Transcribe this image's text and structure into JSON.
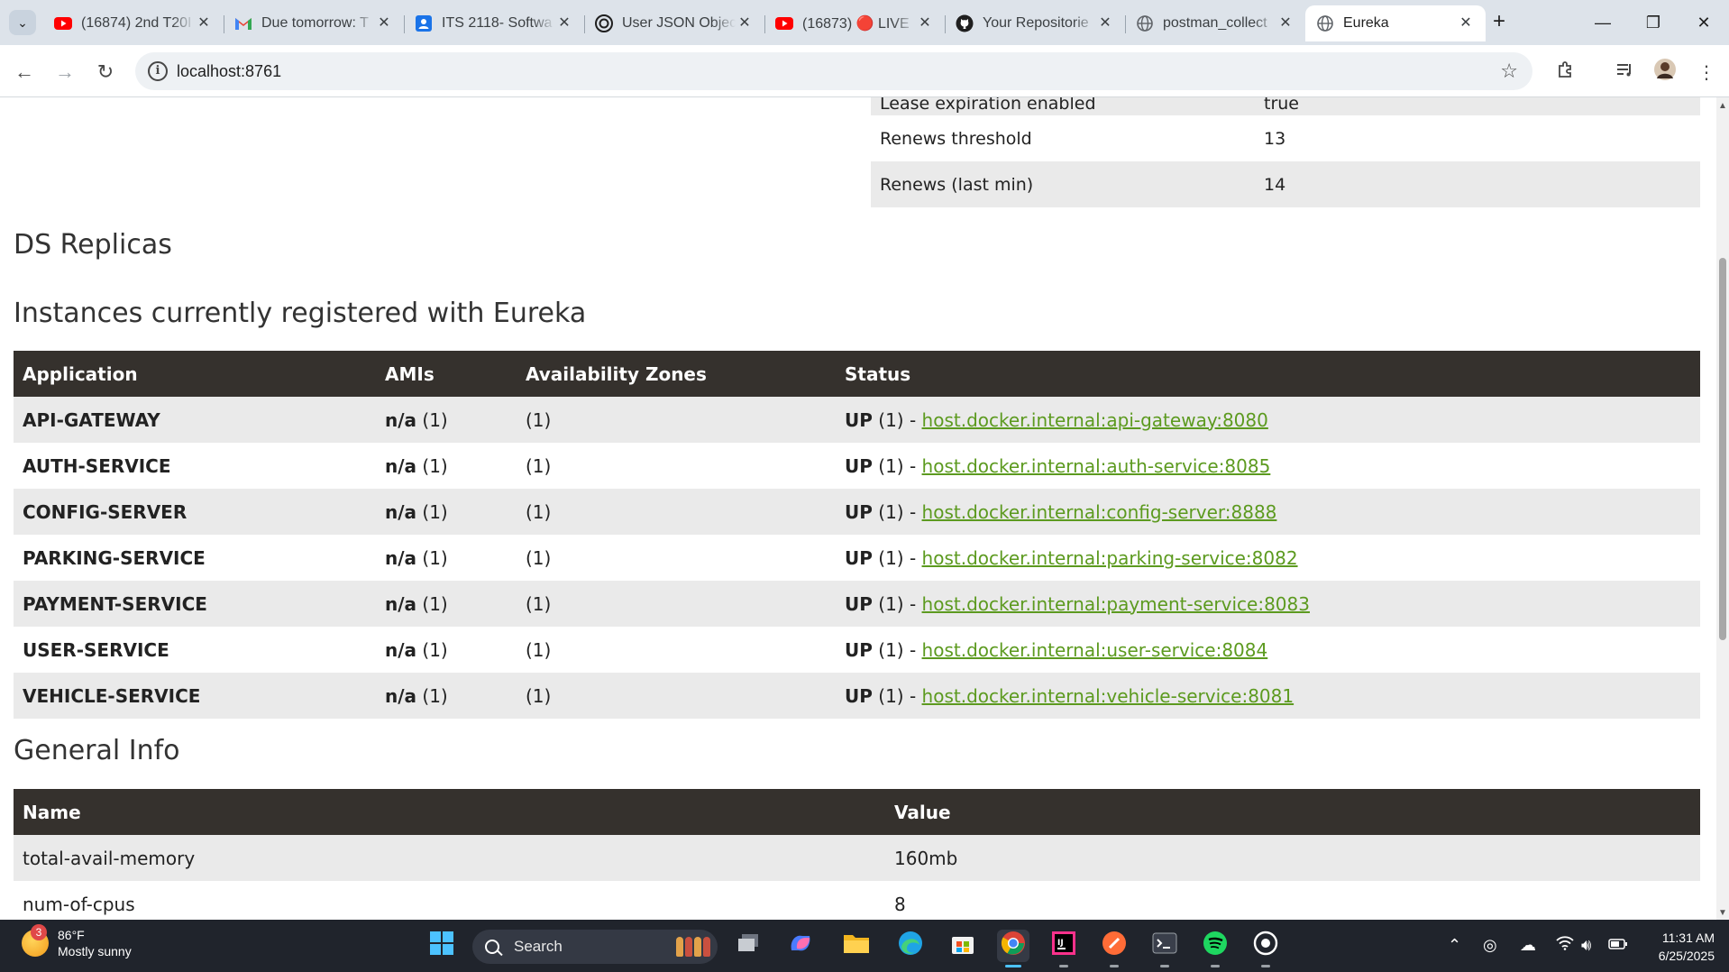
{
  "browser": {
    "tabs": [
      {
        "title": "(16874) 2nd T20I",
        "icon": "youtube-icon",
        "color": "#ff0000"
      },
      {
        "title": "Due tomorrow: T",
        "icon": "gmail-icon",
        "color": "#ea4335"
      },
      {
        "title": "ITS 2118- Softwa",
        "icon": "contacts-icon",
        "color": "#1a73e8"
      },
      {
        "title": "User JSON Objec",
        "icon": "openai-icon",
        "color": "#1f1f1f"
      },
      {
        "title": "(16873) 🔴 LIVE",
        "icon": "youtube-icon",
        "color": "#ff0000"
      },
      {
        "title": "Your Repositorie",
        "icon": "github-icon",
        "color": "#1f1f1f"
      },
      {
        "title": "postman_collect",
        "icon": "globe-icon",
        "color": "#5f6368"
      },
      {
        "title": "Eureka",
        "icon": "globe-icon",
        "color": "#5f6368",
        "active": true
      }
    ],
    "url": "localhost:8761"
  },
  "lease_info": {
    "rows": [
      {
        "key": "Lease expiration enabled",
        "value": "true"
      },
      {
        "key": "Renews threshold",
        "value": "13"
      },
      {
        "key": "Renews (last min)",
        "value": "14"
      }
    ]
  },
  "sections": {
    "ds_replicas": "DS Replicas",
    "instances": "Instances currently registered with Eureka",
    "general_info": "General Info"
  },
  "instances_table": {
    "headers": [
      "Application",
      "AMIs",
      "Availability Zones",
      "Status"
    ],
    "rows": [
      {
        "app": "API-GATEWAY",
        "amis_bold": "n/a",
        "amis_count": "(1)",
        "zones": "(1)",
        "status_bold": "UP",
        "status_count": "(1) -",
        "link": "host.docker.internal:api-gateway:8080"
      },
      {
        "app": "AUTH-SERVICE",
        "amis_bold": "n/a",
        "amis_count": "(1)",
        "zones": "(1)",
        "status_bold": "UP",
        "status_count": "(1) -",
        "link": "host.docker.internal:auth-service:8085"
      },
      {
        "app": "CONFIG-SERVER",
        "amis_bold": "n/a",
        "amis_count": "(1)",
        "zones": "(1)",
        "status_bold": "UP",
        "status_count": "(1) -",
        "link": "host.docker.internal:config-server:8888"
      },
      {
        "app": "PARKING-SERVICE",
        "amis_bold": "n/a",
        "amis_count": "(1)",
        "zones": "(1)",
        "status_bold": "UP",
        "status_count": "(1) -",
        "link": "host.docker.internal:parking-service:8082"
      },
      {
        "app": "PAYMENT-SERVICE",
        "amis_bold": "n/a",
        "amis_count": "(1)",
        "zones": "(1)",
        "status_bold": "UP",
        "status_count": "(1) -",
        "link": "host.docker.internal:payment-service:8083"
      },
      {
        "app": "USER-SERVICE",
        "amis_bold": "n/a",
        "amis_count": "(1)",
        "zones": "(1)",
        "status_bold": "UP",
        "status_count": "(1) -",
        "link": "host.docker.internal:user-service:8084"
      },
      {
        "app": "VEHICLE-SERVICE",
        "amis_bold": "n/a",
        "amis_count": "(1)",
        "zones": "(1)",
        "status_bold": "UP",
        "status_count": "(1) -",
        "link": "host.docker.internal:vehicle-service:8081"
      }
    ]
  },
  "general_info_table": {
    "headers": [
      "Name",
      "Value"
    ],
    "rows": [
      {
        "name": "total-avail-memory",
        "value": "160mb"
      },
      {
        "name": "num-of-cpus",
        "value": "8"
      }
    ]
  },
  "taskbar": {
    "weather_temp": "86°F",
    "weather_desc": "Mostly sunny",
    "weather_badge": "3",
    "search_label": "Search",
    "time": "11:31 AM",
    "date": "6/25/2025"
  },
  "colors": {
    "table_header_bg": "#35312d",
    "link": "#5c9a1f",
    "row_alt": "#eaeaea"
  }
}
